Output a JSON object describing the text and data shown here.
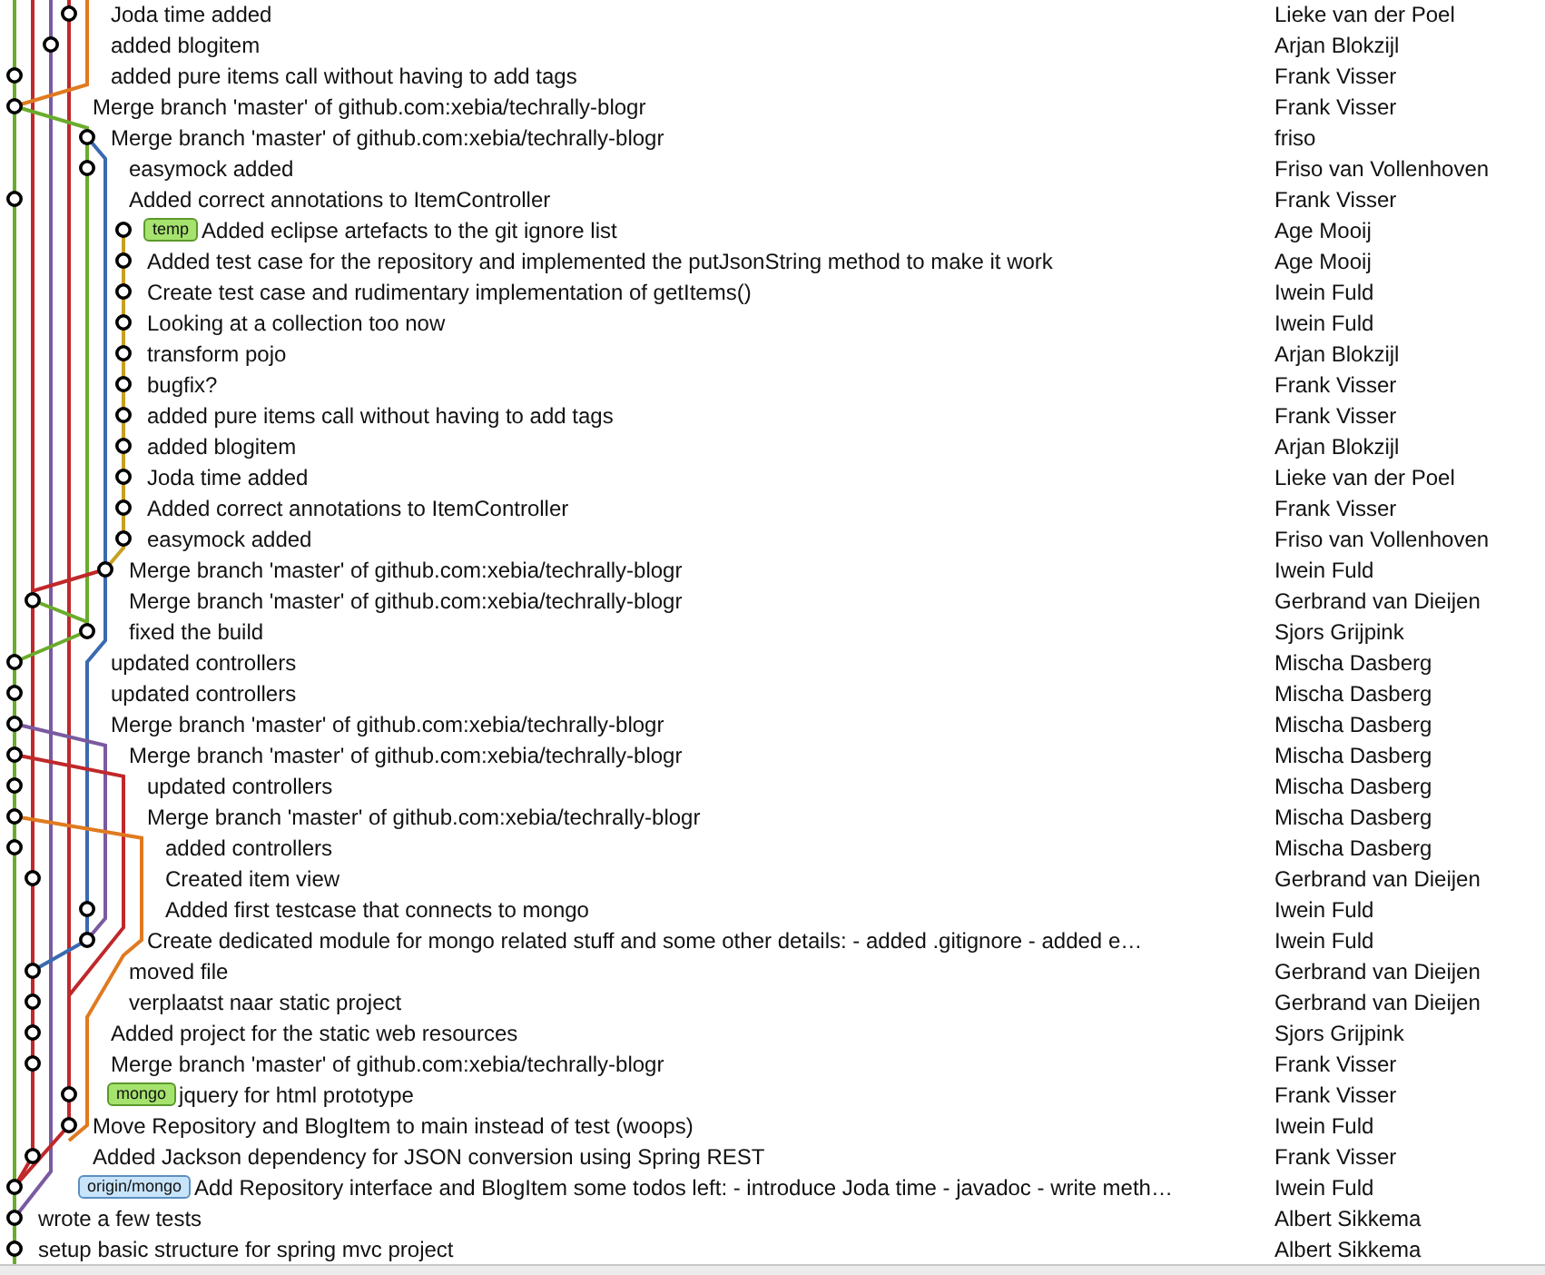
{
  "commits": [
    {
      "subject": "Joda time added",
      "author": "Lieke van der Poel"
    },
    {
      "subject": "added blogitem",
      "author": "Arjan Blokzijl"
    },
    {
      "subject": "added pure items call without having to add tags",
      "author": "Frank Visser"
    },
    {
      "subject": "Merge branch 'master' of github.com:xebia/techrally-blogr",
      "author": "Frank Visser"
    },
    {
      "subject": "Merge branch 'master' of github.com:xebia/techrally-blogr",
      "author": "friso"
    },
    {
      "subject": "easymock added",
      "author": "Friso van Vollenhoven"
    },
    {
      "subject": "Added correct annotations to ItemController",
      "author": "Frank Visser"
    },
    {
      "subject": "Added eclipse artefacts to the git ignore list",
      "author": "Age Mooij",
      "refs": [
        {
          "label": "temp",
          "kind": "local"
        }
      ]
    },
    {
      "subject": "Added test case for the repository and implemented the putJsonString method to make it work",
      "author": "Age Mooij"
    },
    {
      "subject": "Create test case and rudimentary implementation of getItems()",
      "author": "Iwein Fuld"
    },
    {
      "subject": "Looking at a collection too now",
      "author": "Iwein Fuld"
    },
    {
      "subject": "transform pojo",
      "author": "Arjan Blokzijl"
    },
    {
      "subject": "bugfix?",
      "author": "Frank Visser"
    },
    {
      "subject": "added pure items call without having to add tags",
      "author": "Frank Visser"
    },
    {
      "subject": "added blogitem",
      "author": "Arjan Blokzijl"
    },
    {
      "subject": "Joda time added",
      "author": "Lieke van der Poel"
    },
    {
      "subject": "Added correct annotations to ItemController",
      "author": "Frank Visser"
    },
    {
      "subject": "easymock added",
      "author": "Friso van Vollenhoven"
    },
    {
      "subject": "Merge branch 'master' of github.com:xebia/techrally-blogr",
      "author": "Iwein Fuld"
    },
    {
      "subject": "Merge branch 'master' of github.com:xebia/techrally-blogr",
      "author": "Gerbrand van Dieijen"
    },
    {
      "subject": "fixed the build",
      "author": "Sjors Grijpink"
    },
    {
      "subject": "updated controllers",
      "author": "Mischa Dasberg"
    },
    {
      "subject": "updated controllers",
      "author": "Mischa Dasberg"
    },
    {
      "subject": "Merge branch 'master' of github.com:xebia/techrally-blogr",
      "author": "Mischa Dasberg"
    },
    {
      "subject": "Merge branch 'master' of github.com:xebia/techrally-blogr",
      "author": "Mischa Dasberg"
    },
    {
      "subject": "updated controllers",
      "author": "Mischa Dasberg"
    },
    {
      "subject": "Merge branch 'master' of github.com:xebia/techrally-blogr",
      "author": "Mischa Dasberg"
    },
    {
      "subject": "added controllers",
      "author": "Mischa Dasberg"
    },
    {
      "subject": "Created item view",
      "author": "Gerbrand van Dieijen"
    },
    {
      "subject": "Added first testcase that connects to mongo",
      "author": "Iwein Fuld"
    },
    {
      "subject": "Create dedicated module for mongo related stuff and some other details: - added .gitignore - added e…",
      "author": "Iwein Fuld"
    },
    {
      "subject": "moved file",
      "author": "Gerbrand van Dieijen"
    },
    {
      "subject": "verplaatst naar static project",
      "author": "Gerbrand van Dieijen"
    },
    {
      "subject": "Added project for the static web resources",
      "author": "Sjors Grijpink"
    },
    {
      "subject": "Merge branch 'master' of github.com:xebia/techrally-blogr",
      "author": "Frank Visser"
    },
    {
      "subject": "jquery for html prototype",
      "author": "Frank Visser",
      "refs": [
        {
          "label": "mongo",
          "kind": "local"
        }
      ]
    },
    {
      "subject": "Move Repository and BlogItem to main instead of test (woops)",
      "author": "Iwein Fuld"
    },
    {
      "subject": "Added Jackson dependency for JSON conversion using Spring REST",
      "author": "Frank Visser"
    },
    {
      "subject": "Add Repository interface and BlogItem some todos left: - introduce Joda time - javadoc - write meth…",
      "author": "Iwein Fuld",
      "refs": [
        {
          "label": "origin/mongo",
          "kind": "remote"
        }
      ]
    },
    {
      "subject": "wrote a few tests",
      "author": "Albert Sikkema"
    },
    {
      "subject": "setup basic structure for spring mvc project",
      "author": "Albert Sikkema"
    }
  ]
}
